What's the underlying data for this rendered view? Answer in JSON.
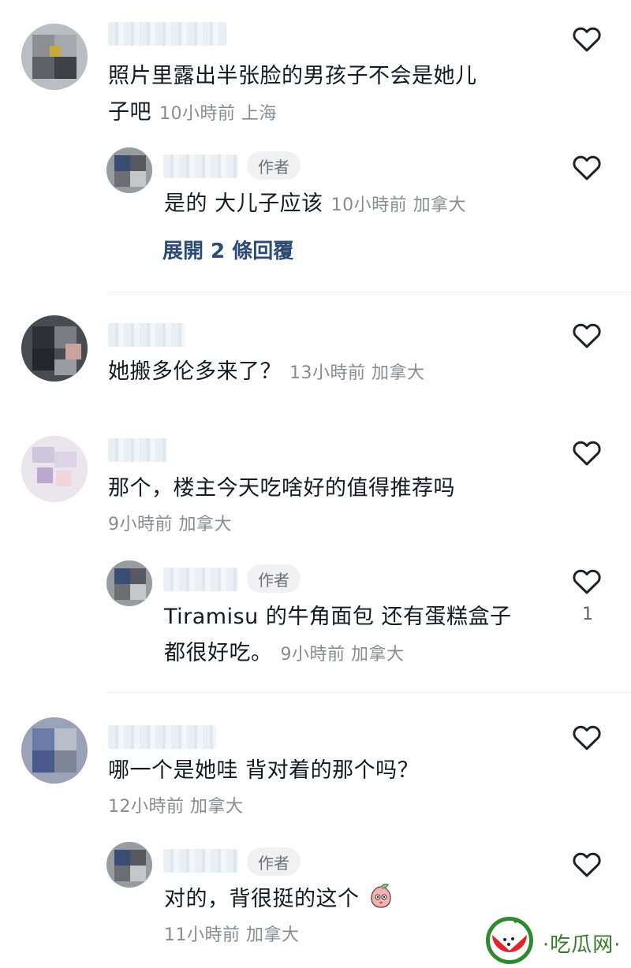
{
  "comments": [
    {
      "text_line1": "照片里露出半张脸的男孩子不会是她儿",
      "text_line2": "子吧",
      "meta": "10小時前 上海",
      "reply": {
        "badge": "作者",
        "text": "是的 大儿子应该",
        "meta": "10小時前 加拿大"
      },
      "expand_label": "展開 2 條回覆"
    },
    {
      "text": "她搬多伦多来了？",
      "meta": "13小時前 加拿大"
    },
    {
      "text": "那个，楼主今天吃啥好的值得推荐吗",
      "meta": "9小時前 加拿大",
      "reply": {
        "badge": "作者",
        "text_line1": "Tiramisu 的牛角面包 还有蛋糕盒子",
        "text_line2": "都很好吃。",
        "meta": "9小時前 加拿大",
        "likes": "1"
      }
    },
    {
      "text": "哪一个是她哇 背对着的那个吗？",
      "meta": "12小時前 加拿大",
      "reply": {
        "badge": "作者",
        "text": "对的，背很挺的这个",
        "meta": "11小時前 加拿大"
      }
    }
  ],
  "icons": {
    "like": "heart-outline-icon",
    "sticker": "peach-face-emoji-icon",
    "watermark_logo": "watermelon-icon"
  },
  "watermark": {
    "text": "·吃瓜网·"
  },
  "colors": {
    "text": "#161823",
    "meta": "#8a8b91",
    "link": "#2b4a74",
    "badge_bg": "#f1f1f2"
  }
}
